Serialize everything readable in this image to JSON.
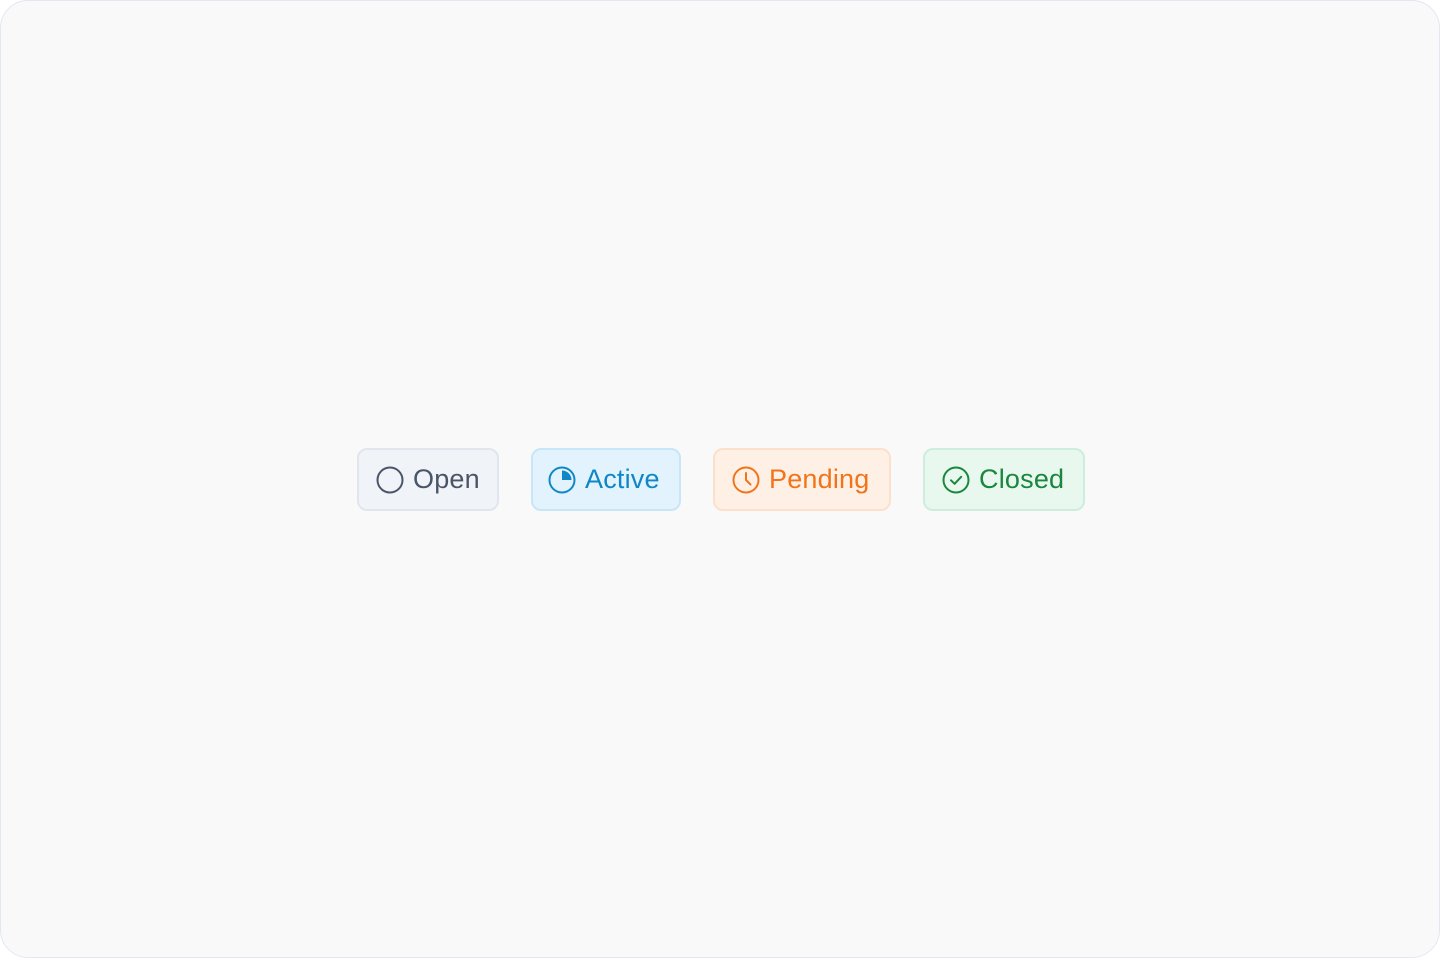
{
  "status_badges": [
    {
      "label": "Open",
      "icon": "open-circle-icon",
      "color": "#4a5568",
      "background": "#f0f3f8"
    },
    {
      "label": "Active",
      "icon": "progress-pie-icon",
      "color": "#0f87c7",
      "background": "#e2f3fd"
    },
    {
      "label": "Pending",
      "icon": "clock-icon",
      "color": "#f2741a",
      "background": "#fff0e6"
    },
    {
      "label": "Closed",
      "icon": "check-circle-icon",
      "color": "#19873d",
      "background": "#e8f8ee"
    }
  ]
}
